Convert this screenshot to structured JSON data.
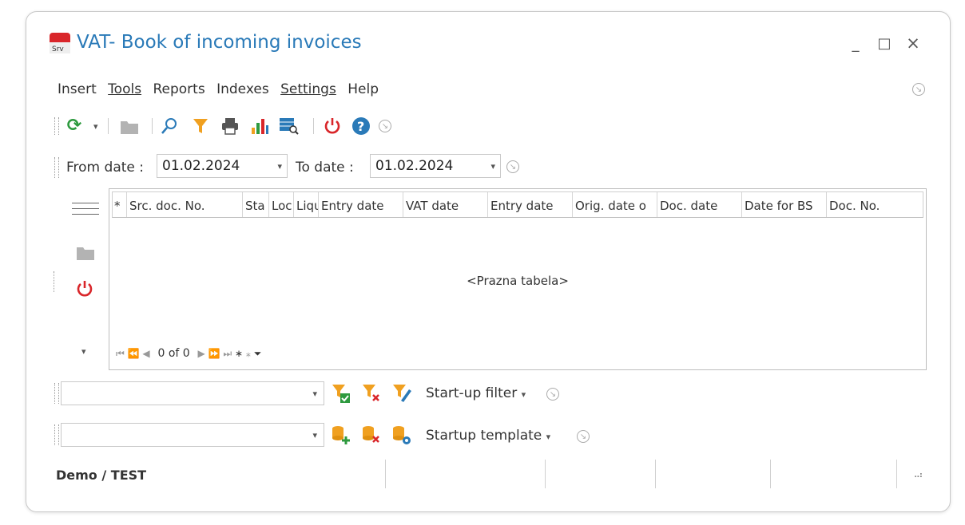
{
  "window": {
    "title": "VAT- Book of incoming invoices",
    "minimize": "_",
    "maximize": "□",
    "close": "×"
  },
  "menu": {
    "insert": "Insert",
    "tools": "Tools",
    "reports": "Reports",
    "indexes": "Indexes",
    "settings": "Settings",
    "help": "Help"
  },
  "filters": {
    "from_label": "From date :",
    "from_value": "01.02.2024",
    "to_label": "To date :",
    "to_value": "01.02.2024"
  },
  "grid": {
    "columns": [
      "*",
      "Src. doc. No.",
      "Sta",
      "Loc",
      "Liqu",
      "Entry date",
      "VAT date",
      "Entry date",
      "Orig. date o",
      "Doc. date",
      "Date for BS",
      "Doc. No."
    ],
    "empty_text": "<Prazna tabela>",
    "record_count": "0 of 0"
  },
  "startup": {
    "filter_value": "",
    "filter_label": "Start-up filter",
    "template_value": "",
    "template_label": "Startup template"
  },
  "statusbar": {
    "text": "Demo / TEST"
  },
  "colors": {
    "accent": "#2a7ab8",
    "red": "#d9262a",
    "green": "#2e9a3f",
    "orange": "#f0a020"
  }
}
